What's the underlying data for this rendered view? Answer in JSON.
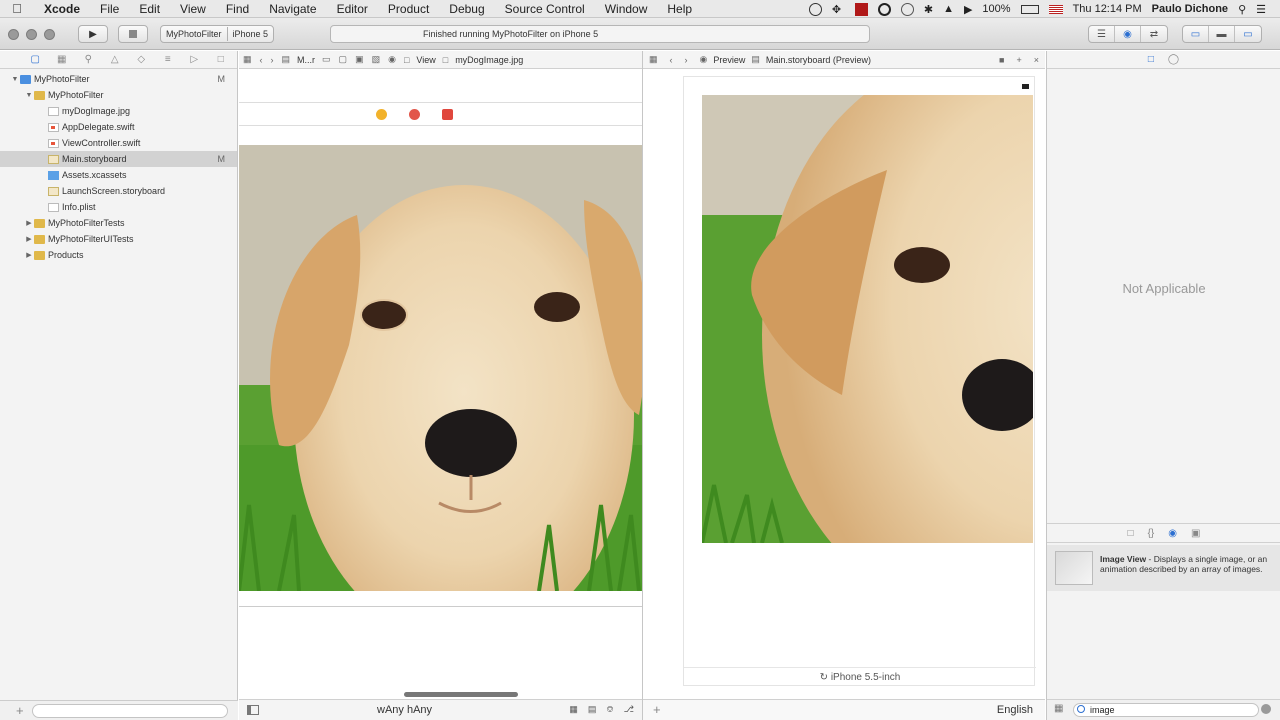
{
  "menubar": {
    "app_name": "Xcode",
    "items": [
      "File",
      "Edit",
      "View",
      "Find",
      "Navigate",
      "Editor",
      "Product",
      "Debug",
      "Source Control",
      "Window",
      "Help"
    ],
    "battery": "100%",
    "clock": "Thu 12:14 PM",
    "user": "Paulo Dichone"
  },
  "toolbar": {
    "scheme": "MyPhotoFilter",
    "device": "iPhone 5",
    "status": "Finished running MyPhotoFilter on iPhone 5"
  },
  "navigator": {
    "items": [
      {
        "label": "MyPhotoFilter",
        "badge": "M"
      },
      {
        "label": "MyPhotoFilter",
        "badge": ""
      },
      {
        "label": "myDogImage.jpg",
        "badge": ""
      },
      {
        "label": "AppDelegate.swift",
        "badge": ""
      },
      {
        "label": "ViewController.swift",
        "badge": ""
      },
      {
        "label": "Main.storyboard",
        "badge": "M"
      },
      {
        "label": "Assets.xcassets",
        "badge": ""
      },
      {
        "label": "LaunchScreen.storyboard",
        "badge": ""
      },
      {
        "label": "Info.plist",
        "badge": ""
      },
      {
        "label": "MyPhotoFilterTests",
        "badge": ""
      },
      {
        "label": "MyPhotoFilterUITests",
        "badge": ""
      },
      {
        "label": "Products",
        "badge": ""
      }
    ]
  },
  "editor": {
    "jumpbar": [
      "M...r",
      "View",
      "myDogImage.jpg"
    ],
    "size_class": "wAny hAny"
  },
  "assistant": {
    "jumpbar": [
      "Preview",
      "Main.storyboard (Preview)"
    ],
    "device_label": "iPhone 5.5-inch",
    "language": "English"
  },
  "inspector": {
    "empty_text": "Not Applicable"
  },
  "library": {
    "item_title": "Image View",
    "item_desc": " - Displays a single image, or an animation described by an array of images.",
    "filter_value": "image"
  }
}
